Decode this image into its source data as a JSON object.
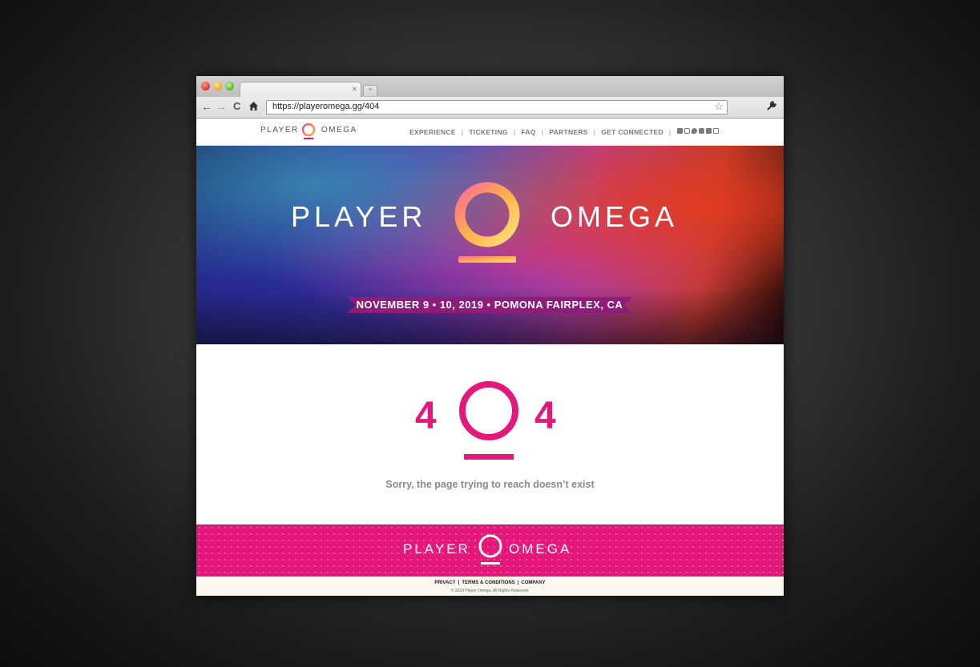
{
  "browser": {
    "url": "https://playeromega.gg/404",
    "tab_close": "×",
    "new_tab": "+",
    "back": "←",
    "forward": "→",
    "reload": "C",
    "star": "☆",
    "wrench": "🔧"
  },
  "site": {
    "brand_left": "PLAYER",
    "brand_right": "OMEGA",
    "nav": [
      "EXPERIENCE",
      "TICKETING",
      "FAQ",
      "PARTNERS",
      "GET CONNECTED"
    ],
    "nav_sep": "|",
    "social": [
      "facebook-icon",
      "instagram-icon",
      "twitter-icon",
      "youtube-icon",
      "discord-icon",
      "twitch-icon"
    ]
  },
  "hero": {
    "title_left": "PLAYER",
    "title_right": "OMEGA",
    "banner": "NOVEMBER 9 • 10, 2019 • POMONA FAIRPLEX, CA"
  },
  "error": {
    "digit_left": "4",
    "digit_right": "4",
    "message": "Sorry, the page trying to reach doesn’t exist"
  },
  "footer": {
    "brand_left": "PLAYER",
    "brand_right": "OMEGA",
    "links": [
      "PRIVACY",
      "TERMS & CONDITIONS",
      "COMPANY"
    ],
    "link_sep": "|",
    "copyright": "© 2019 Player Omega. All Rights Reserved."
  },
  "colors": {
    "accent": "#e5177b",
    "banner": "#8e1c7a"
  }
}
